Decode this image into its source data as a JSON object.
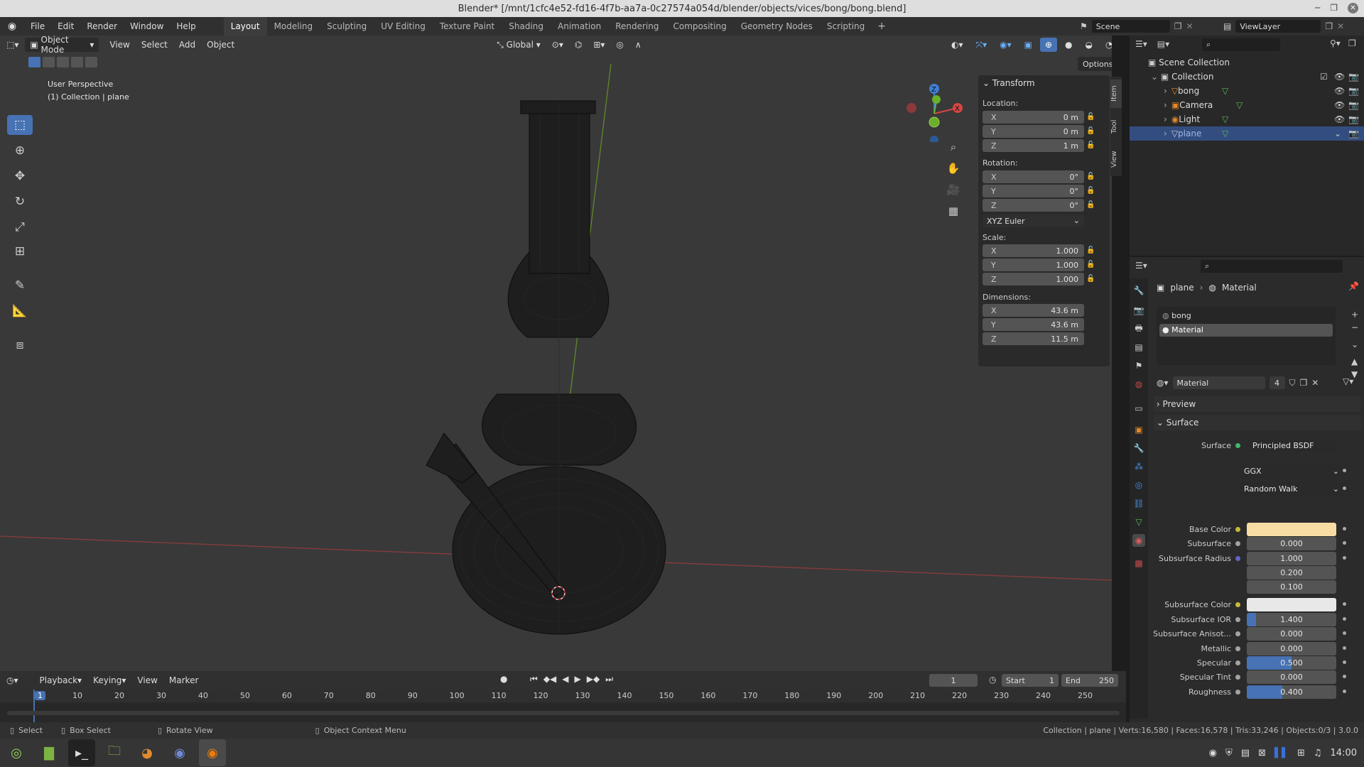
{
  "window": {
    "title": "Blender* [/mnt/1cfc4e52-fd16-4f7b-aa7a-0c27574a054d/blender/objects/vices/bong/bong.blend]"
  },
  "menu": [
    "File",
    "Edit",
    "Render",
    "Window",
    "Help"
  ],
  "workspaces": [
    "Layout",
    "Modeling",
    "Sculpting",
    "UV Editing",
    "Texture Paint",
    "Shading",
    "Animation",
    "Rendering",
    "Compositing",
    "Geometry Nodes",
    "Scripting"
  ],
  "active_workspace": "Layout",
  "scene": {
    "name": "Scene",
    "view_layer": "ViewLayer"
  },
  "viewport": {
    "mode": "Object Mode",
    "header_menus": [
      "View",
      "Select",
      "Add",
      "Object"
    ],
    "orientation": "Global",
    "options_label": "Options",
    "info_line1": "User Perspective",
    "info_line2": "(1) Collection | plane",
    "tools": [
      "select-box-icon",
      "cursor-icon",
      "move-icon",
      "rotate-icon",
      "scale-icon",
      "transform-icon",
      "annotate-icon",
      "measure-icon",
      "add-cube-icon"
    ],
    "gizmo_axes": [
      "X",
      "Y",
      "Z"
    ]
  },
  "transform": {
    "header": "Transform",
    "location_label": "Location:",
    "location": [
      {
        "axis": "X",
        "value": "0 m"
      },
      {
        "axis": "Y",
        "value": "0 m"
      },
      {
        "axis": "Z",
        "value": "1 m"
      }
    ],
    "rotation_label": "Rotation:",
    "rotation": [
      {
        "axis": "X",
        "value": "0°"
      },
      {
        "axis": "Y",
        "value": "0°"
      },
      {
        "axis": "Z",
        "value": "0°"
      }
    ],
    "rotation_mode": "XYZ Euler",
    "scale_label": "Scale:",
    "scale": [
      {
        "axis": "X",
        "value": "1.000"
      },
      {
        "axis": "Y",
        "value": "1.000"
      },
      {
        "axis": "Z",
        "value": "1.000"
      }
    ],
    "dimensions_label": "Dimensions:",
    "dimensions": [
      {
        "axis": "X",
        "value": "43.6 m"
      },
      {
        "axis": "Y",
        "value": "43.6 m"
      },
      {
        "axis": "Z",
        "value": "11.5 m"
      }
    ]
  },
  "side_tabs": [
    "Item",
    "Tool",
    "View"
  ],
  "outliner": {
    "scene_collection": "Scene Collection",
    "collection": "Collection",
    "items": [
      "bong",
      "Camera",
      "Light",
      "plane"
    ],
    "selected": "plane"
  },
  "properties": {
    "breadcrumb_object": "plane",
    "breadcrumb_material": "Material",
    "slots": [
      "bong",
      "Material"
    ],
    "material_name": "Material",
    "users": "4",
    "preview_label": "Preview",
    "surface_label": "Surface",
    "surface_shader_label": "Surface",
    "surface_shader": "Principled BSDF",
    "distribution": "GGX",
    "subsurface_method": "Random Walk",
    "fields": [
      {
        "label": "Base Color",
        "value": "",
        "color": "#f7dca4",
        "fill": 0
      },
      {
        "label": "Subsurface",
        "value": "0.000",
        "fill": 0
      },
      {
        "label": "Subsurface Radius",
        "value": "1.000",
        "fill": 0
      },
      {
        "label": "",
        "value": "0.200",
        "fill": 0
      },
      {
        "label": "",
        "value": "0.100",
        "fill": 0
      },
      {
        "label": "Subsurface Color",
        "value": "",
        "color": "#e8e8e8",
        "fill": 0
      },
      {
        "label": "Subsurface IOR",
        "value": "1.400",
        "fill": 0.1
      },
      {
        "label": "Subsurface Anisot...",
        "value": "0.000",
        "fill": 0
      },
      {
        "label": "Metallic",
        "value": "0.000",
        "fill": 0
      },
      {
        "label": "Specular",
        "value": "0.500",
        "fill": 0.5
      },
      {
        "label": "Specular Tint",
        "value": "0.000",
        "fill": 0
      },
      {
        "label": "Roughness",
        "value": "0.400",
        "fill": 0.4
      }
    ]
  },
  "timeline": {
    "menus": [
      "Playback",
      "Keying",
      "View",
      "Marker"
    ],
    "current_frame": "1",
    "start_label": "Start",
    "start": "1",
    "end_label": "End",
    "end": "250",
    "ruler": [
      "1",
      "10",
      "20",
      "30",
      "40",
      "50",
      "60",
      "70",
      "80",
      "90",
      "100",
      "110",
      "120",
      "130",
      "140",
      "150",
      "160",
      "170",
      "180",
      "190",
      "200",
      "210",
      "220",
      "230",
      "240",
      "250"
    ]
  },
  "status": {
    "select": "Select",
    "box_select": "Box Select",
    "rotate_view": "Rotate View",
    "context_menu": "Object Context Menu",
    "stats": "Collection | plane | Verts:16,580 | Faces:16,578 | Tris:33,246 | Objects:0/3 | 3.0.0"
  },
  "taskbar": {
    "clock": "14:00"
  },
  "colors": {
    "accent": "#4772b3",
    "base_color": "#f7dca4",
    "subsurface_color": "#e8e8e8"
  }
}
